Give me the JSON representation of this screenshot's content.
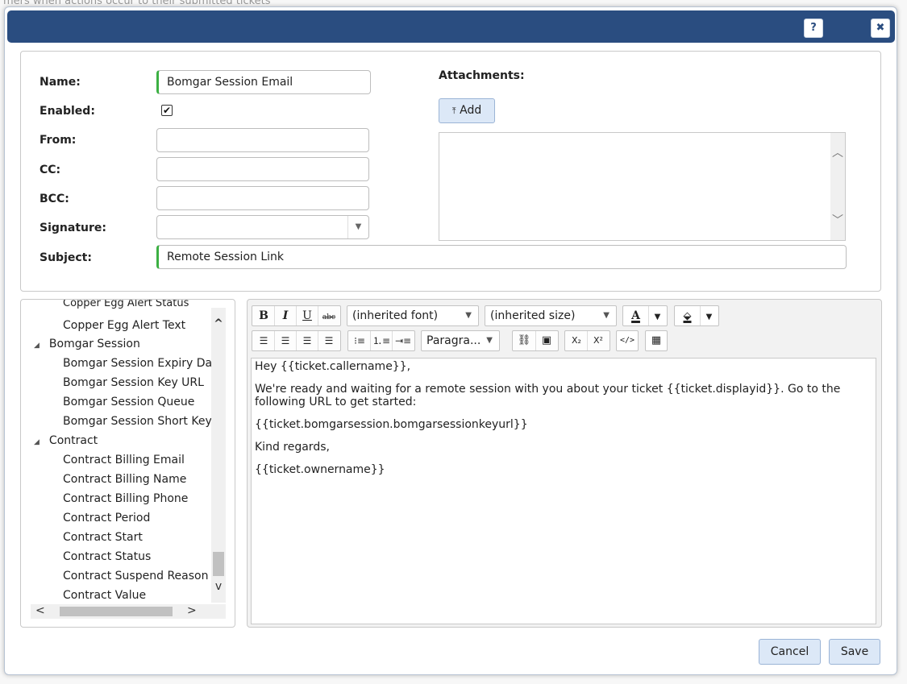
{
  "background_text": "mers when actions occur to their submitted tickets",
  "titlebar": {
    "help_label": "?",
    "close_label": "✖"
  },
  "form": {
    "name_label": "Name:",
    "name_value": "Bomgar Session Email",
    "enabled_label": "Enabled:",
    "enabled_checked": "✔",
    "from_label": "From:",
    "from_value": "",
    "cc_label": "CC:",
    "cc_value": "",
    "bcc_label": "BCC:",
    "bcc_value": "",
    "signature_label": "Signature:",
    "signature_value": "",
    "subject_label": "Subject:",
    "subject_value": "Remote Session Link"
  },
  "attachments": {
    "label": "Attachments:",
    "add_label": "Add",
    "add_icon": "⤒"
  },
  "tree": {
    "partial_top": "Copper Egg Alert Status",
    "items": [
      {
        "label": "Copper Egg Alert Text",
        "level": 1
      },
      {
        "label": "Bomgar Session",
        "level": 0
      },
      {
        "label": "Bomgar Session Expiry Date",
        "level": 1
      },
      {
        "label": "Bomgar Session Key URL",
        "level": 1
      },
      {
        "label": "Bomgar Session Queue",
        "level": 1
      },
      {
        "label": "Bomgar Session Short Key",
        "level": 1
      },
      {
        "label": "Contract",
        "level": 0
      },
      {
        "label": "Contract Billing Email",
        "level": 1
      },
      {
        "label": "Contract Billing Name",
        "level": 1
      },
      {
        "label": "Contract Billing Phone",
        "level": 1
      },
      {
        "label": "Contract Period",
        "level": 1
      },
      {
        "label": "Contract Start",
        "level": 1
      },
      {
        "label": "Contract Status",
        "level": 1
      },
      {
        "label": "Contract Suspend Reason",
        "level": 1
      },
      {
        "label": "Contract Value",
        "level": 1
      }
    ]
  },
  "toolbar": {
    "bold": "B",
    "italic": "I",
    "underline": "U",
    "strike": "abc",
    "font": "(inherited font)",
    "size": "(inherited size)",
    "font_color": "A",
    "highlight": "⬙",
    "format": "Paragra...",
    "subscript": "X₂",
    "superscript": "X²",
    "html": "</>"
  },
  "editor": {
    "greeting": "Hey {{ticket.callername}},",
    "body": "We're ready and waiting for a remote session with you about your ticket {{ticket.displayid}}. Go to the following URL to get started:",
    "link": "{{ticket.bomgarsession.bomgarsessionkeyurl}}",
    "closing": "Kind regards,",
    "owner": "{{ticket.ownername}}"
  },
  "footer": {
    "cancel_label": "Cancel",
    "save_label": "Save"
  },
  "colors": {
    "titlebar": "#2a4d80",
    "required": "#3cb043",
    "button": "#dce8f7"
  }
}
